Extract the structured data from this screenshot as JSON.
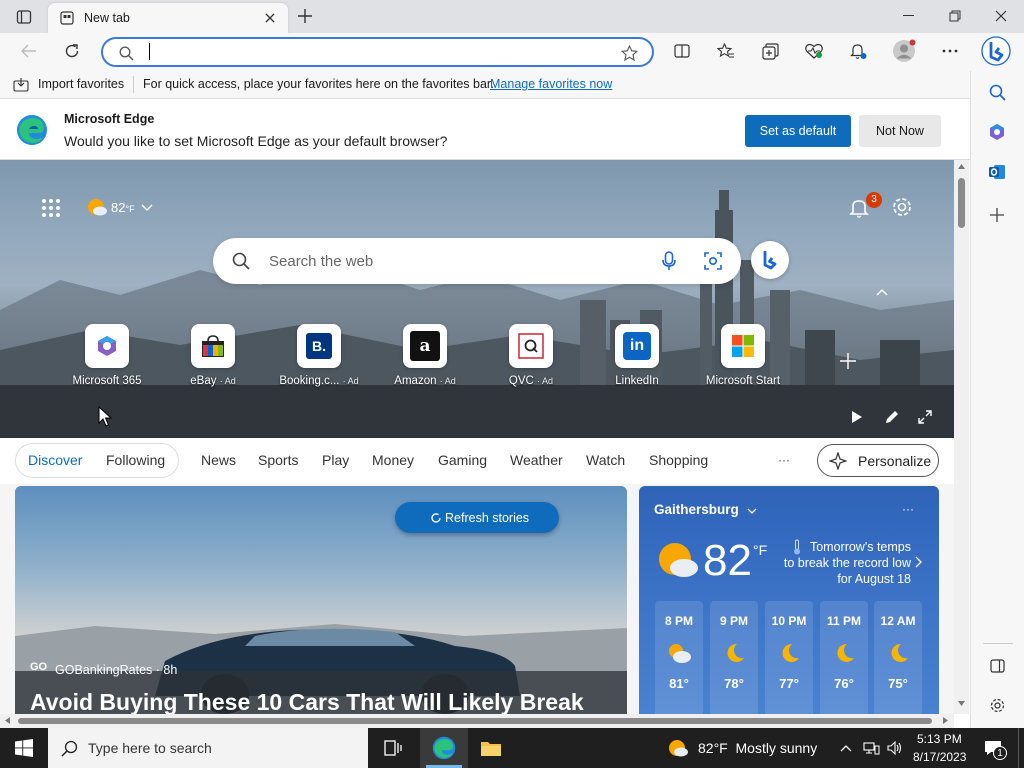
{
  "tab": {
    "title": "New tab"
  },
  "favorites_bar": {
    "import_label": "Import favorites",
    "hint": "For quick access, place your favorites here on the favorites bar.",
    "manage_link": "Manage favorites now"
  },
  "infobar": {
    "title": "Microsoft Edge",
    "message": "Would you like to set Microsoft Edge as your default browser?",
    "set_default": "Set as default",
    "not_now": "Not Now"
  },
  "hero": {
    "weather_temp": "82",
    "weather_unit": "°F",
    "notification_count": "3",
    "search_placeholder": "Search the web"
  },
  "quick_links": [
    {
      "label": "Microsoft 365",
      "ad": ""
    },
    {
      "label": "eBay",
      "ad": "· Ad"
    },
    {
      "label": "Booking.c...",
      "ad": "· Ad"
    },
    {
      "label": "Amazon",
      "ad": "· Ad"
    },
    {
      "label": "QVC",
      "ad": "· Ad"
    },
    {
      "label": "LinkedIn",
      "ad": ""
    },
    {
      "label": "Microsoft Start",
      "ad": ""
    }
  ],
  "feed_nav": {
    "discover": "Discover",
    "following": "Following",
    "tabs": [
      "News",
      "Sports",
      "Play",
      "Money",
      "Gaming",
      "Weather",
      "Watch",
      "Shopping"
    ],
    "more": "···",
    "personalize": "Personalize"
  },
  "story": {
    "refresh_label": "Refresh stories",
    "source_badge": "GO",
    "source": "GOBankingRates · 8h",
    "headline": "Avoid Buying These 10 Cars That Will Likely Break"
  },
  "weather_card": {
    "location": "Gaithersburg",
    "more": "···",
    "temp": "82",
    "unit": "°F",
    "note_line1": "Tomorrow's temps",
    "note_line2": "to break the record low",
    "note_line3": "for August 18",
    "hourly": [
      {
        "hour": "8 PM",
        "temp": "81°",
        "icon": "partly-cloudy-icon"
      },
      {
        "hour": "9 PM",
        "temp": "78°",
        "icon": "moon-icon"
      },
      {
        "hour": "10 PM",
        "temp": "77°",
        "icon": "moon-icon"
      },
      {
        "hour": "11 PM",
        "temp": "76°",
        "icon": "moon-icon"
      },
      {
        "hour": "12 AM",
        "temp": "75°",
        "icon": "moon-icon"
      }
    ]
  },
  "taskbar": {
    "search_placeholder": "Type here to search",
    "weather": "82°F  Mostly sunny",
    "time": "5:13 PM",
    "date": "8/17/2023",
    "notification_count": "1"
  },
  "colors": {
    "accent": "#0f6cbd",
    "taskbar": "#1f1f1f",
    "weather_card": "#3b72c6"
  }
}
